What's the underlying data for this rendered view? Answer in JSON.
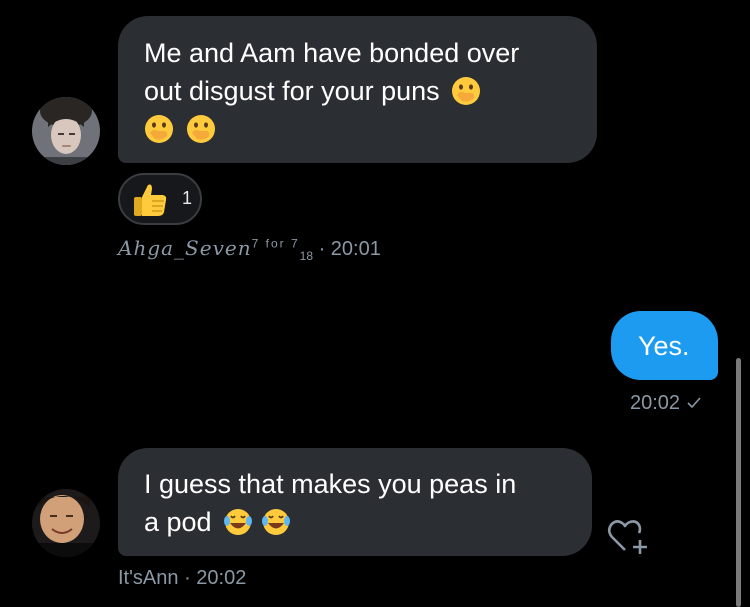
{
  "messages": [
    {
      "sender": "Ahga_Seven",
      "line1": "Me and Aam have bonded over",
      "line2": "out disgust for your puns",
      "emoji": "face-with-hand-over-mouth",
      "reaction": {
        "emoji": "thumbs-up",
        "count": "1"
      },
      "meta": {
        "name": "Ahga_Seven",
        "sup": "7 for 7",
        "sub": "18",
        "time": "· 20:01"
      }
    },
    {
      "sender": "me",
      "text": "Yes.",
      "meta": {
        "time": "20:02",
        "status_icon": "check-icon"
      }
    },
    {
      "sender": "It'sAnn",
      "line1": "I guess that makes you peas in",
      "line2": "a pod",
      "emoji": "face-with-tears-of-joy",
      "meta": {
        "name": "It'sAnn",
        "time": "· 20:02"
      }
    }
  ],
  "actions": {
    "like_icon": "heart-plus-icon"
  },
  "colors": {
    "incoming_bubble": "#2b2e33",
    "outgoing_bubble": "#1d9bf0",
    "meta_text": "#8b98a5",
    "background": "#000000"
  }
}
